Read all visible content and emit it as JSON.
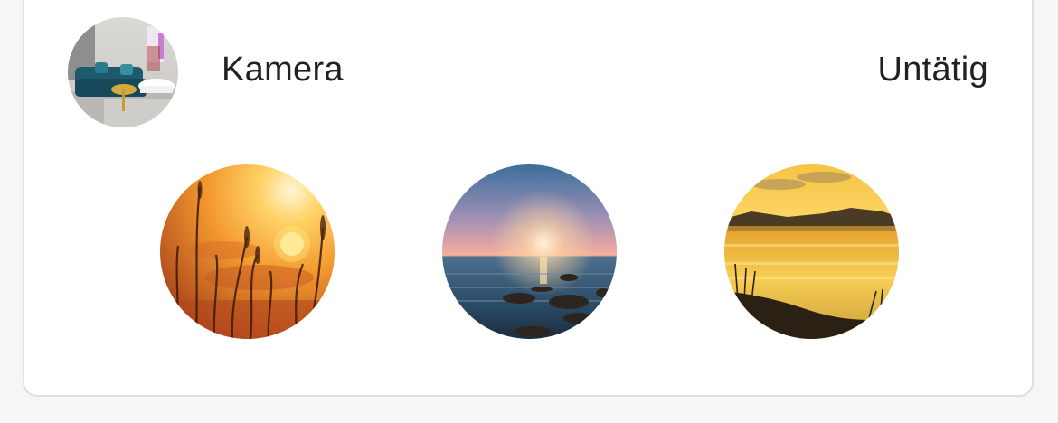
{
  "entity": {
    "name": "Kamera",
    "state": "Untätig",
    "thumbnail_icon": "living-room-camera-snapshot"
  },
  "scenes": [
    {
      "icon": "sunset-grass-image"
    },
    {
      "icon": "sunset-sea-image"
    },
    {
      "icon": "sunrise-lake-image"
    }
  ]
}
